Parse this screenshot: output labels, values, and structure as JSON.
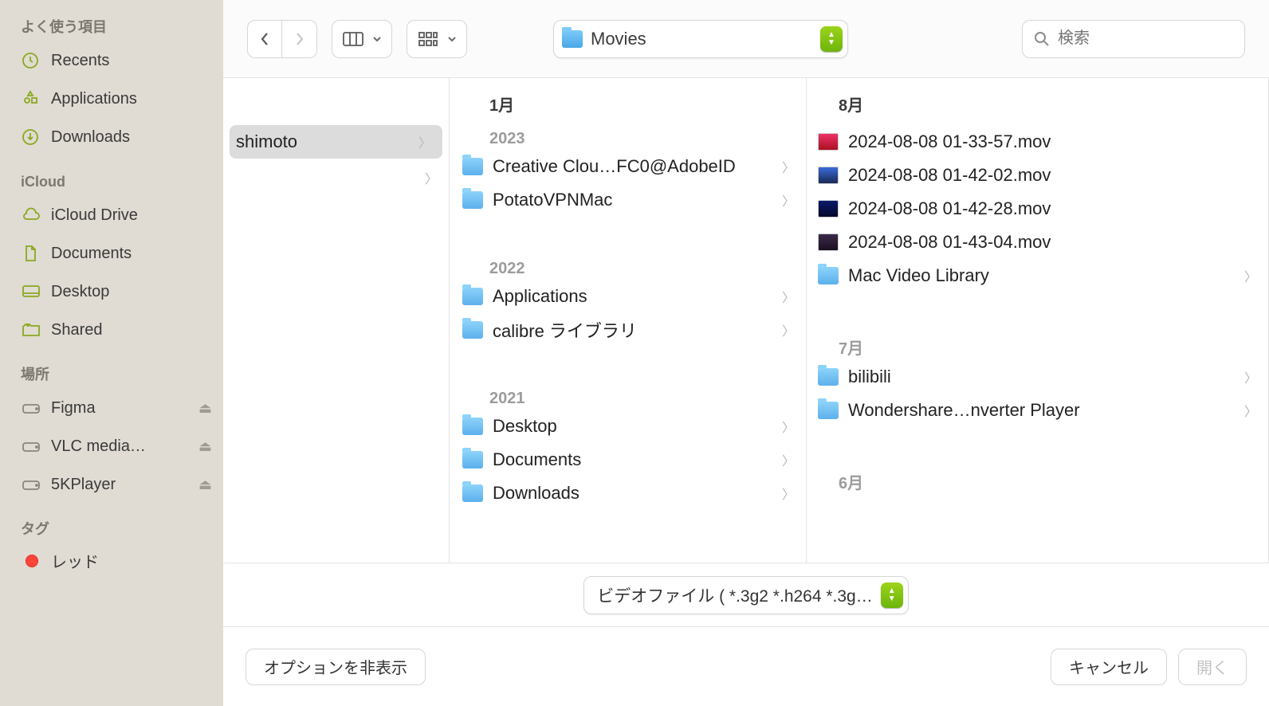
{
  "sidebar": {
    "favorites_label": "よく使う項目",
    "favorites": [
      {
        "label": "Recents"
      },
      {
        "label": "Applications"
      },
      {
        "label": "Downloads"
      }
    ],
    "icloud_label": "iCloud",
    "icloud": [
      {
        "label": "iCloud Drive"
      },
      {
        "label": "Documents"
      },
      {
        "label": "Desktop"
      },
      {
        "label": "Shared"
      }
    ],
    "locations_label": "場所",
    "locations": [
      {
        "label": "Figma",
        "ejectable": true
      },
      {
        "label": "VLC media…",
        "ejectable": true
      },
      {
        "label": "5KPlayer",
        "ejectable": true
      }
    ],
    "tags_label": "タグ",
    "tags": [
      {
        "label": "レッド",
        "color": "#ff443a"
      }
    ]
  },
  "toolbar": {
    "location_title": "Movies",
    "search_placeholder": "検索"
  },
  "columns": {
    "col0": {
      "items": [
        {
          "label": "shimoto",
          "is_folder": false,
          "selected": true
        }
      ],
      "after_chevron": true
    },
    "col1": {
      "header": "1月",
      "groups": [
        {
          "year": "2023",
          "items": [
            {
              "label": "Creative Clou…FC0@AdobeID",
              "is_folder": true,
              "chevron": true
            },
            {
              "label": "PotatoVPNMac",
              "is_folder": true,
              "chevron": true
            }
          ]
        },
        {
          "year": "2022",
          "items": [
            {
              "label": "Applications",
              "is_folder": true,
              "chevron": true
            },
            {
              "label": "calibre ライブラリ",
              "is_folder": true,
              "chevron": true
            }
          ]
        },
        {
          "year": "2021",
          "items": [
            {
              "label": "Desktop",
              "is_folder": true,
              "chevron": true
            },
            {
              "label": "Documents",
              "is_folder": true,
              "chevron": true
            },
            {
              "label": "Downloads",
              "is_folder": true,
              "chevron": true
            }
          ]
        }
      ]
    },
    "col2": {
      "header": "8月",
      "groups": [
        {
          "year": "",
          "items": [
            {
              "label": "2024-08-08 01-33-57.mov",
              "is_folder": false,
              "thumb": "a"
            },
            {
              "label": "2024-08-08 01-42-02.mov",
              "is_folder": false,
              "thumb": "b"
            },
            {
              "label": "2024-08-08 01-42-28.mov",
              "is_folder": false,
              "thumb": "c"
            },
            {
              "label": "2024-08-08 01-43-04.mov",
              "is_folder": false,
              "thumb": "d"
            },
            {
              "label": "Mac Video Library",
              "is_folder": true,
              "chevron": true
            }
          ]
        },
        {
          "year": "7月",
          "items": [
            {
              "label": "bilibili",
              "is_folder": true,
              "chevron": true
            },
            {
              "label": "Wondershare…nverter Player",
              "is_folder": true,
              "chevron": true
            }
          ]
        },
        {
          "year": "6月",
          "items": []
        }
      ]
    }
  },
  "filter": {
    "label": "ビデオファイル ( *.3g2 *.h264 *.3g…"
  },
  "footer": {
    "options": "オプションを非表示",
    "cancel": "キャンセル",
    "open": "開く"
  }
}
